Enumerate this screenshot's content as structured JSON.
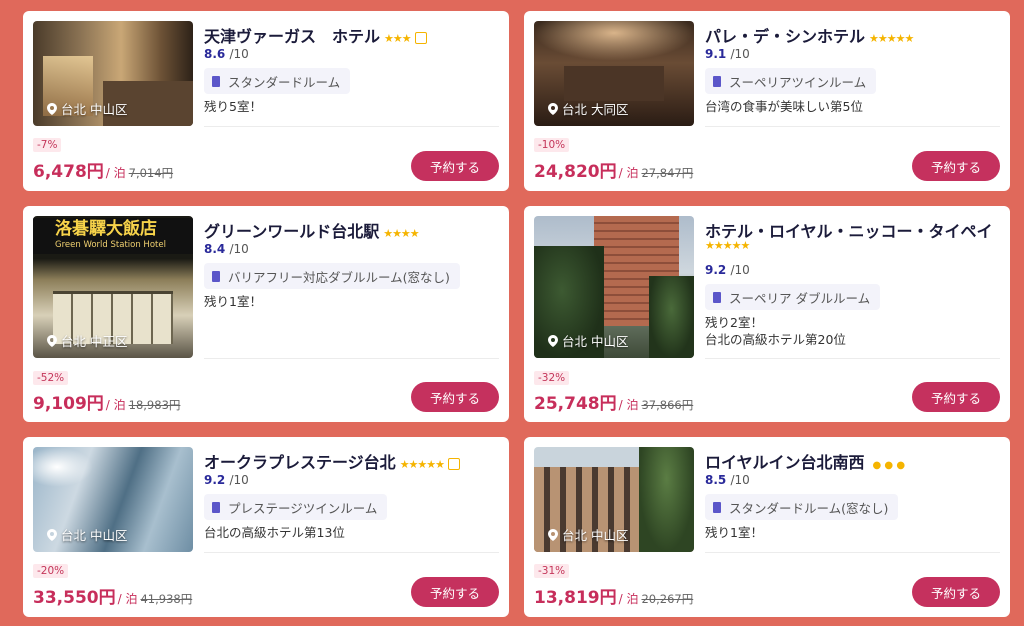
{
  "common": {
    "score_suffix": "/10",
    "per_night": "/ 泊",
    "book_label": "予約する"
  },
  "hotels": [
    {
      "name": "天津ヴァーガス　ホテル",
      "stars": "★★★",
      "score": "8.6",
      "room": "スタンダードルーム",
      "notes": [
        "残り5室！"
      ],
      "location": "台北 中山区",
      "discount": "-7%",
      "price": "6,478円",
      "original_price": "7,014円"
    },
    {
      "name": "パレ・デ・シンホテル",
      "stars": "★★★★★",
      "score": "9.1",
      "room": "スーペリアツインルーム",
      "notes": [
        "台湾の食事が美味しい第5位"
      ],
      "location": "台北 大同区",
      "discount": "-10%",
      "price": "24,820円",
      "original_price": "27,847円"
    },
    {
      "name": "グリーンワールド台北駅",
      "stars": "★★★★",
      "score": "8.4",
      "room": "バリアフリー対応ダブルルーム(窓なし)",
      "notes": [
        "残り1室！"
      ],
      "location": "台北 中正区",
      "sign_text": "洛碁驛大飯店",
      "sign_sub": "Green World Station Hotel",
      "discount": "-52%",
      "price": "9,109円",
      "original_price": "18,983円"
    },
    {
      "name": "ホテル・ロイヤル・ニッコー・タイペイ",
      "stars": "★★★★★",
      "score": "9.2",
      "room": "スーペリア ダブルルーム",
      "notes": [
        "残り2室！",
        "台北の高級ホテル第20位"
      ],
      "location": "台北 中山区",
      "discount": "-32%",
      "price": "25,748円",
      "original_price": "37,866円"
    },
    {
      "name": "オークラプレステージ台北",
      "stars": "★★★★★",
      "score": "9.2",
      "room": "プレステージツインルーム",
      "notes": [
        "台北の高級ホテル第13位"
      ],
      "location": "台北 中山区",
      "discount": "-20%",
      "price": "33,550円",
      "original_price": "41,938円"
    },
    {
      "name": "ロイヤルイン台北南西",
      "stars": "● ● ●",
      "score": "8.5",
      "room": "スタンダードルーム(窓なし)",
      "notes": [
        "残り1室！"
      ],
      "location": "台北 中山区",
      "discount": "-31%",
      "price": "13,819円",
      "original_price": "20,267円"
    }
  ],
  "colors": {
    "background": "#e0695b",
    "price": "#c72e5b",
    "button": "#c5315e",
    "score": "#2a2a9a",
    "stars": "#f5b400"
  }
}
